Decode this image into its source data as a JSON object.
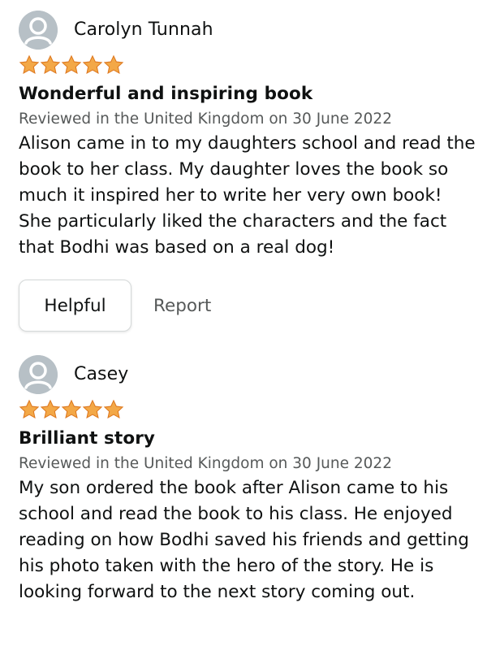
{
  "colors": {
    "star": "#f3a847",
    "star_outline": "#de7921",
    "avatar_bg": "#b7c0c6",
    "text": "#0f1111",
    "muted": "#565959"
  },
  "reviews": [
    {
      "reviewer": "Carolyn Tunnah",
      "rating": 5,
      "title": "Wonderful and inspiring book",
      "meta": "Reviewed in the United Kingdom on 30 June 2022",
      "body": "Alison came in to my daughters school and read the book to her class. My daughter loves the book so much it inspired her to write her very own book! She particularly liked the characters and the fact that Bodhi was based on a real dog!",
      "helpful_label": "Helpful",
      "report_label": "Report"
    },
    {
      "reviewer": "Casey",
      "rating": 5,
      "title": "Brilliant story",
      "meta": "Reviewed in the United Kingdom on 30 June 2022",
      "body": "My son ordered the book after Alison came to his school and read the book to his class. He enjoyed reading on how Bodhi saved his friends and getting his photo taken with the hero of the story. He is looking forward to the next story coming out."
    }
  ]
}
